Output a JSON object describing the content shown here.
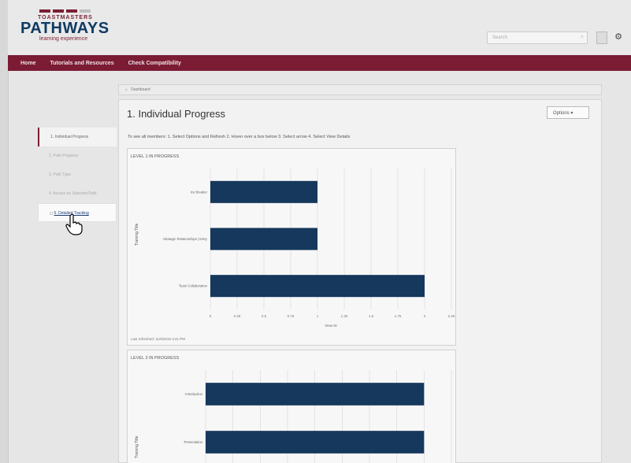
{
  "header": {
    "logo_top": "TOASTMASTERS",
    "logo_main": "PATHWAYS",
    "logo_sub": "learning experience",
    "search_placeholder": "Search"
  },
  "nav": [
    "Home",
    "Tutorials and Resources",
    "Check Compatibility"
  ],
  "breadcrumb": "Dashboard",
  "page": {
    "title": "1. Individual Progress",
    "options_label": "Options",
    "instructions": "To see all members: 1. Select Options and Refresh 2. Hover over a box below 3. Select arrow 4. Select View Details"
  },
  "sidenav": [
    "1. Individual Progress",
    "2. Path Progress",
    "3. Path Type",
    "4. Access by Selected Path",
    "5. Detailed Tracking"
  ],
  "panel1": {
    "title": "LEVEL 1 IN PROGRESS",
    "y_axis_title": "Training Title",
    "x_axis_title": "View ID",
    "last_refreshed": "Last refreshed: 11/6/2016 3:41 PM"
  },
  "panel2": {
    "title": "LEVEL 2 IN PROGRESS",
    "y_axis_title": "Training Title"
  },
  "chart_data": [
    {
      "type": "bar",
      "orientation": "horizontal",
      "title": "LEVEL 1 IN PROGRESS",
      "categories": [
        "Ice Breaker",
        "Strategic Relationships | Entry",
        "Team Collaboration"
      ],
      "values": [
        1,
        1,
        2
      ],
      "xlabel": "View ID",
      "ylabel": "Training Title",
      "xticks": [
        "0",
        "0.25",
        "0.5",
        "0.75",
        "1",
        "1.25",
        "1.5",
        "1.75",
        "2",
        "2.25"
      ],
      "xlim": [
        0,
        2.25
      ],
      "grid": true,
      "bar_color": "#15385c"
    },
    {
      "type": "bar",
      "orientation": "horizontal",
      "title": "LEVEL 2 IN PROGRESS",
      "categories": [
        "Introduction",
        "Presentation"
      ],
      "values": [
        2,
        2
      ],
      "ylabel": "Training Title",
      "xlim": [
        0,
        2.25
      ],
      "grid": true,
      "bar_color": "#15385c"
    }
  ],
  "colors": {
    "brand_maroon": "#7b1c34",
    "brand_navy": "#0f3a63",
    "bar": "#15385c"
  }
}
